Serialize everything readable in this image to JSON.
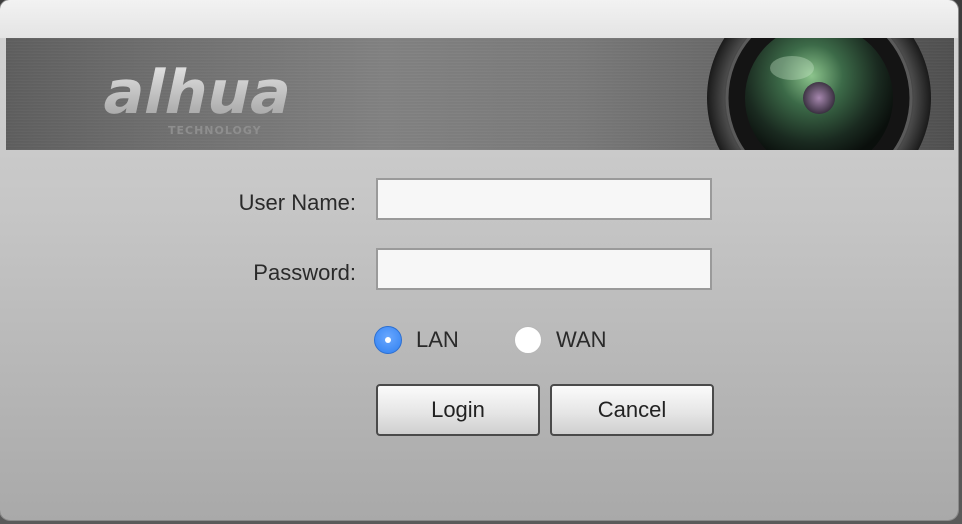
{
  "brand": {
    "logo_text": "alhua",
    "logo_subtext": "TECHNOLOGY"
  },
  "form": {
    "username_label": "User Name:",
    "username_value": "",
    "password_label": "Password:",
    "password_value": ""
  },
  "network": {
    "options": [
      "LAN",
      "WAN"
    ],
    "lan_label": "LAN",
    "wan_label": "WAN",
    "selected": "LAN"
  },
  "buttons": {
    "login_label": "Login",
    "cancel_label": "Cancel"
  },
  "colors": {
    "radio_selected": "#2e7ff0",
    "banner": "#7a7a7a"
  }
}
